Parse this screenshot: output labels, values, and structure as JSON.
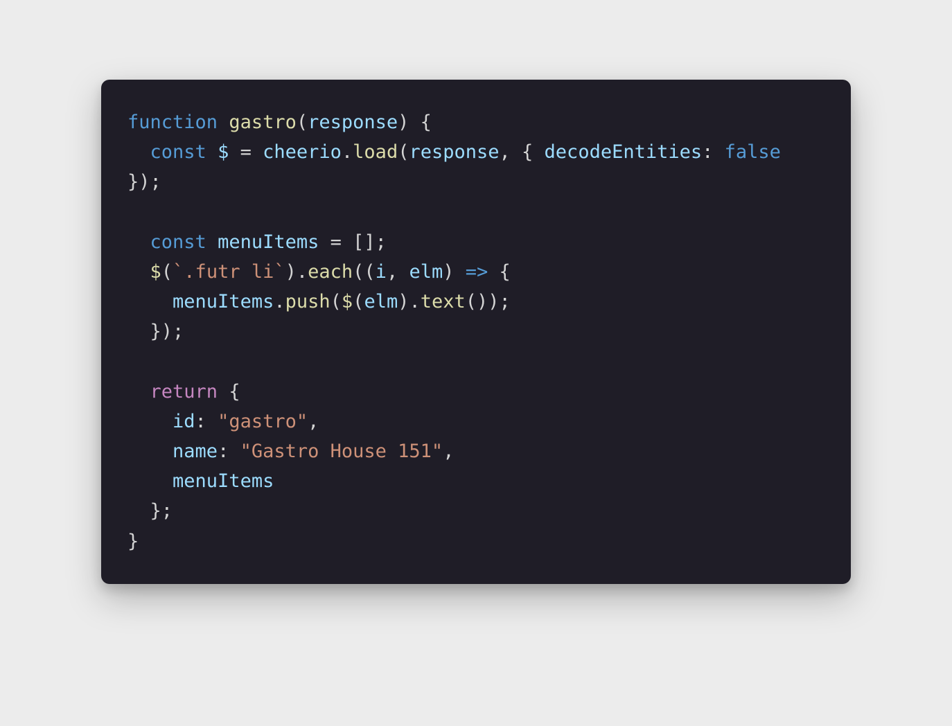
{
  "code": {
    "tokens": [
      {
        "cls": "kw-function",
        "t": "function"
      },
      {
        "cls": "punct",
        "t": " "
      },
      {
        "cls": "fn-name",
        "t": "gastro"
      },
      {
        "cls": "punct",
        "t": "("
      },
      {
        "cls": "var-name",
        "t": "response"
      },
      {
        "cls": "punct",
        "t": ") {"
      },
      {
        "cls": "newline",
        "t": "\n"
      },
      {
        "cls": "punct",
        "t": "  "
      },
      {
        "cls": "kw-const",
        "t": "const"
      },
      {
        "cls": "punct",
        "t": " "
      },
      {
        "cls": "var-name",
        "t": "$"
      },
      {
        "cls": "punct",
        "t": " = "
      },
      {
        "cls": "var-name",
        "t": "cheerio"
      },
      {
        "cls": "punct",
        "t": "."
      },
      {
        "cls": "method",
        "t": "load"
      },
      {
        "cls": "punct",
        "t": "("
      },
      {
        "cls": "var-name",
        "t": "response"
      },
      {
        "cls": "punct",
        "t": ", { "
      },
      {
        "cls": "prop",
        "t": "decodeEntities"
      },
      {
        "cls": "punct",
        "t": ": "
      },
      {
        "cls": "kw-false",
        "t": "false"
      },
      {
        "cls": "punct",
        "t": " });"
      },
      {
        "cls": "newline",
        "t": "\n"
      },
      {
        "cls": "newline",
        "t": "\n"
      },
      {
        "cls": "punct",
        "t": "  "
      },
      {
        "cls": "kw-const",
        "t": "const"
      },
      {
        "cls": "punct",
        "t": " "
      },
      {
        "cls": "var-name",
        "t": "menuItems"
      },
      {
        "cls": "punct",
        "t": " = [];"
      },
      {
        "cls": "newline",
        "t": "\n"
      },
      {
        "cls": "punct",
        "t": "  "
      },
      {
        "cls": "method",
        "t": "$"
      },
      {
        "cls": "punct",
        "t": "("
      },
      {
        "cls": "template",
        "t": "`.futr li`"
      },
      {
        "cls": "punct",
        "t": ")."
      },
      {
        "cls": "method",
        "t": "each"
      },
      {
        "cls": "punct",
        "t": "(("
      },
      {
        "cls": "var-name",
        "t": "i"
      },
      {
        "cls": "punct",
        "t": ", "
      },
      {
        "cls": "var-name",
        "t": "elm"
      },
      {
        "cls": "punct",
        "t": ") "
      },
      {
        "cls": "arrow",
        "t": "=>"
      },
      {
        "cls": "punct",
        "t": " {"
      },
      {
        "cls": "newline",
        "t": "\n"
      },
      {
        "cls": "punct",
        "t": "    "
      },
      {
        "cls": "var-name",
        "t": "menuItems"
      },
      {
        "cls": "punct",
        "t": "."
      },
      {
        "cls": "method",
        "t": "push"
      },
      {
        "cls": "punct",
        "t": "("
      },
      {
        "cls": "method",
        "t": "$"
      },
      {
        "cls": "punct",
        "t": "("
      },
      {
        "cls": "var-name",
        "t": "elm"
      },
      {
        "cls": "punct",
        "t": ")."
      },
      {
        "cls": "method",
        "t": "text"
      },
      {
        "cls": "punct",
        "t": "());"
      },
      {
        "cls": "newline",
        "t": "\n"
      },
      {
        "cls": "punct",
        "t": "  });"
      },
      {
        "cls": "newline",
        "t": "\n"
      },
      {
        "cls": "newline",
        "t": "\n"
      },
      {
        "cls": "punct",
        "t": "  "
      },
      {
        "cls": "kw-return",
        "t": "return"
      },
      {
        "cls": "punct",
        "t": " {"
      },
      {
        "cls": "newline",
        "t": "\n"
      },
      {
        "cls": "punct",
        "t": "    "
      },
      {
        "cls": "prop",
        "t": "id"
      },
      {
        "cls": "punct",
        "t": ": "
      },
      {
        "cls": "string",
        "t": "\"gastro\""
      },
      {
        "cls": "punct",
        "t": ","
      },
      {
        "cls": "newline",
        "t": "\n"
      },
      {
        "cls": "punct",
        "t": "    "
      },
      {
        "cls": "prop",
        "t": "name"
      },
      {
        "cls": "punct",
        "t": ": "
      },
      {
        "cls": "string",
        "t": "\"Gastro House 151\""
      },
      {
        "cls": "punct",
        "t": ","
      },
      {
        "cls": "newline",
        "t": "\n"
      },
      {
        "cls": "punct",
        "t": "    "
      },
      {
        "cls": "var-name",
        "t": "menuItems"
      },
      {
        "cls": "newline",
        "t": "\n"
      },
      {
        "cls": "punct",
        "t": "  };"
      },
      {
        "cls": "newline",
        "t": "\n"
      },
      {
        "cls": "punct",
        "t": "}"
      }
    ]
  }
}
